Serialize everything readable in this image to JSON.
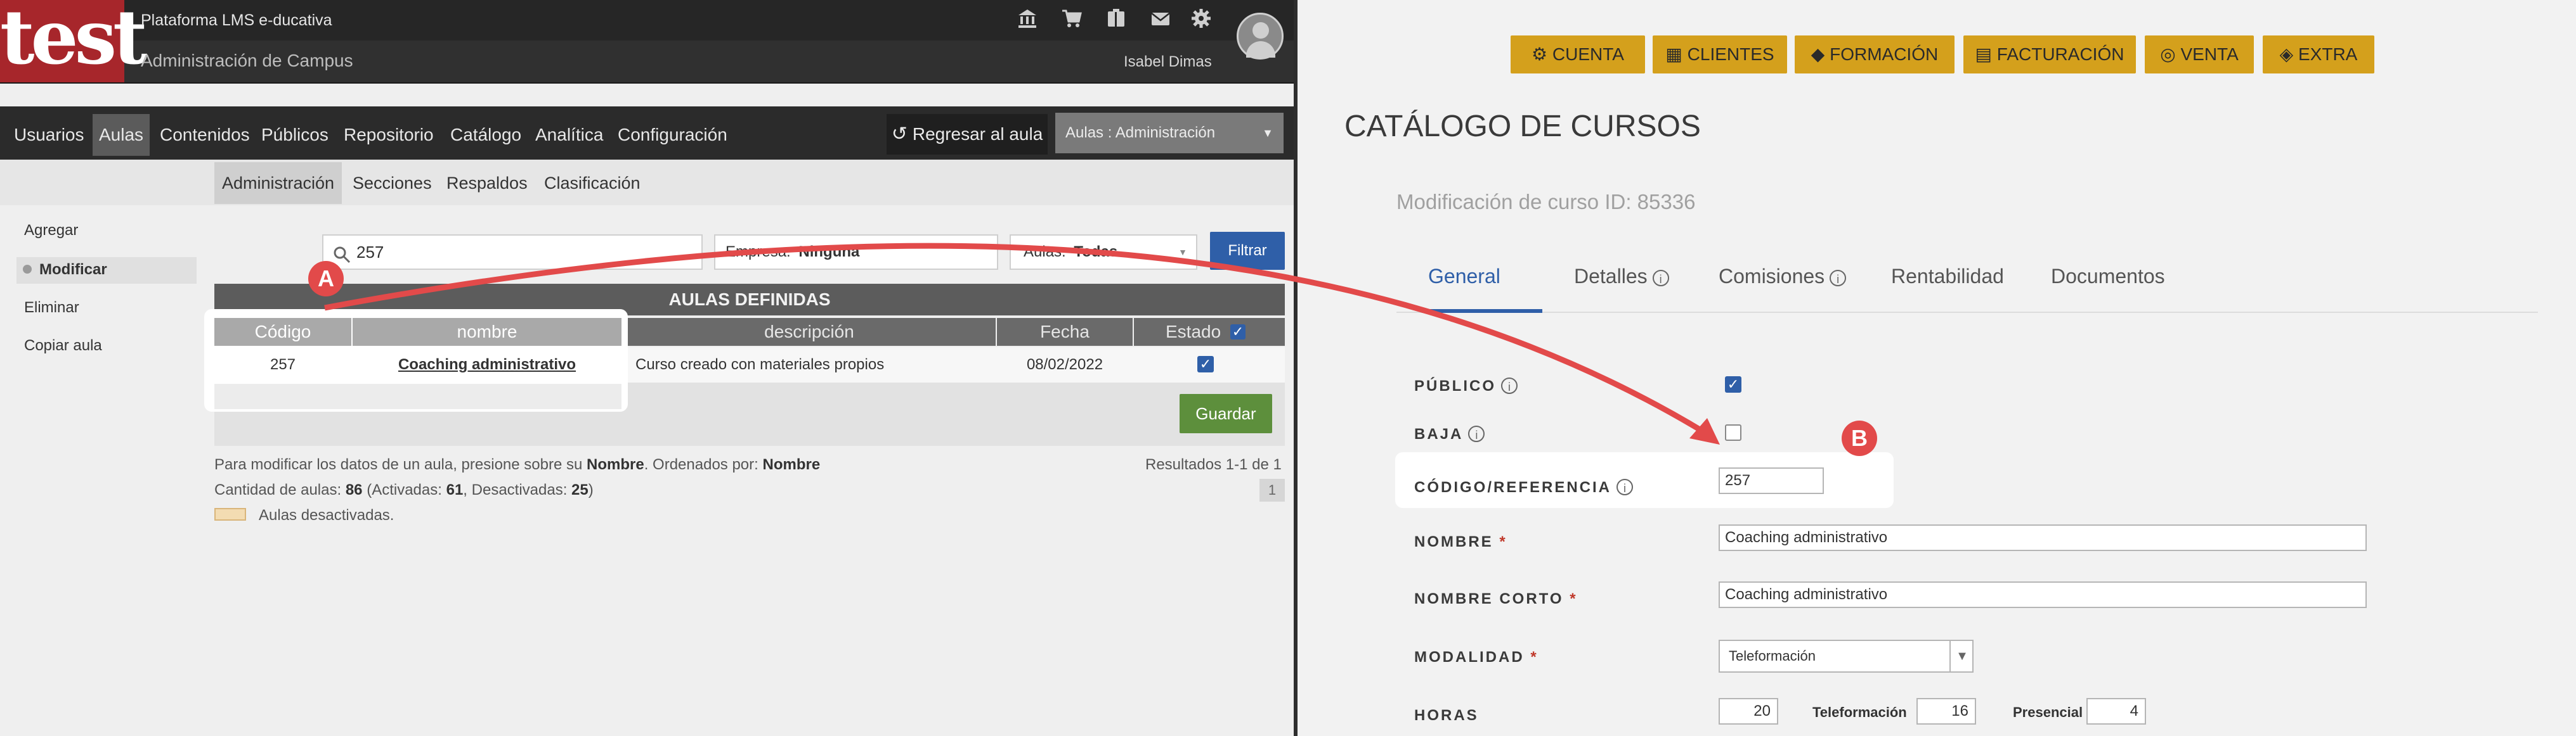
{
  "app": {
    "logo_text": "test",
    "platform_name": "Plataforma LMS e-ducativa",
    "admin_title": "Administración de Campus",
    "user_name": "Isabel Dimas",
    "top_icons": [
      "bank-icon",
      "cart-icon",
      "book-icon",
      "mail-icon",
      "gear-icon"
    ]
  },
  "nav": {
    "items": [
      "Usuarios",
      "Aulas",
      "Contenidos",
      "Públicos",
      "Repositorio",
      "Catálogo",
      "Analítica",
      "Configuración"
    ],
    "active": "Aulas",
    "return_label": "Regresar al aula",
    "aula_select": "Aulas : Administración"
  },
  "subnav": {
    "items": [
      "Administración",
      "Secciones",
      "Respaldos",
      "Clasificación"
    ],
    "active": "Administración"
  },
  "sidebar": {
    "items": [
      "Agregar",
      "Modificar",
      "Eliminar",
      "Copiar aula"
    ],
    "active": "Modificar"
  },
  "filters": {
    "search_value": "257",
    "empresa_label": "Empresa:",
    "empresa_value": "Ninguna",
    "aulas_label": "Aulas:",
    "aulas_value": "Todas",
    "filter_button": "Filtrar"
  },
  "table": {
    "title": "AULAS DEFINIDAS",
    "headers": [
      "Código",
      "nombre",
      "descripción",
      "Fecha",
      "Estado"
    ],
    "rows": [
      {
        "codigo": "257",
        "nombre": "Coaching administrativo",
        "descripcion": "Curso creado con materiales propios",
        "fecha": "08/02/2022",
        "estado_checked": true
      }
    ],
    "save_button": "Guardar"
  },
  "footer": {
    "help_prefix": "Para modificar los datos de un aula, presione sobre su",
    "help_bold1": "Nombre",
    "help_mid": ". Ordenados por:",
    "help_bold2": "Nombre",
    "count_prefix": "Cantidad de aulas:",
    "count_total": "86",
    "count_activadas_label": "(Activadas:",
    "count_activadas": "61",
    "count_desactivadas_label": ", Desactivadas:",
    "count_desactivadas": "25",
    "count_close": ")",
    "results": "Resultados 1-1 de 1",
    "page": "1",
    "legend": "Aulas desactivadas."
  },
  "annotations": {
    "badge_a": "A",
    "badge_b": "B",
    "arrow_color": "#e24a4a"
  },
  "right": {
    "top_buttons": [
      "CUENTA",
      "CLIENTES",
      "FORMACIÓN",
      "FACTURACIÓN",
      "VENTA",
      "EXTRA"
    ],
    "title": "CATÁLOGO DE CURSOS",
    "subtitle": "Modificación de curso ID: 85336",
    "tabs": [
      "General",
      "Detalles",
      "Comisiones",
      "Rentabilidad",
      "Documentos"
    ],
    "active_tab": "General",
    "fields": {
      "publico_label": "PÚBLICO",
      "publico_checked": true,
      "baja_label": "BAJA",
      "baja_checked": false,
      "codigo_label": "CÓDIGO/REFERENCIA",
      "codigo_value": "257",
      "nombre_label": "NOMBRE",
      "nombre_value": "Coaching administrativo",
      "nombre_corto_label": "NOMBRE CORTO",
      "nombre_corto_value": "Coaching administrativo",
      "modalidad_label": "MODALIDAD",
      "modalidad_value": "Teleformación",
      "horas_label": "HORAS",
      "horas_value": "20",
      "teleformacion_label": "Teleformación",
      "teleformacion_value": "16",
      "presencial_label": "Presencial",
      "presencial_value": "4",
      "required_mark": "*",
      "info_glyph": "i"
    }
  }
}
